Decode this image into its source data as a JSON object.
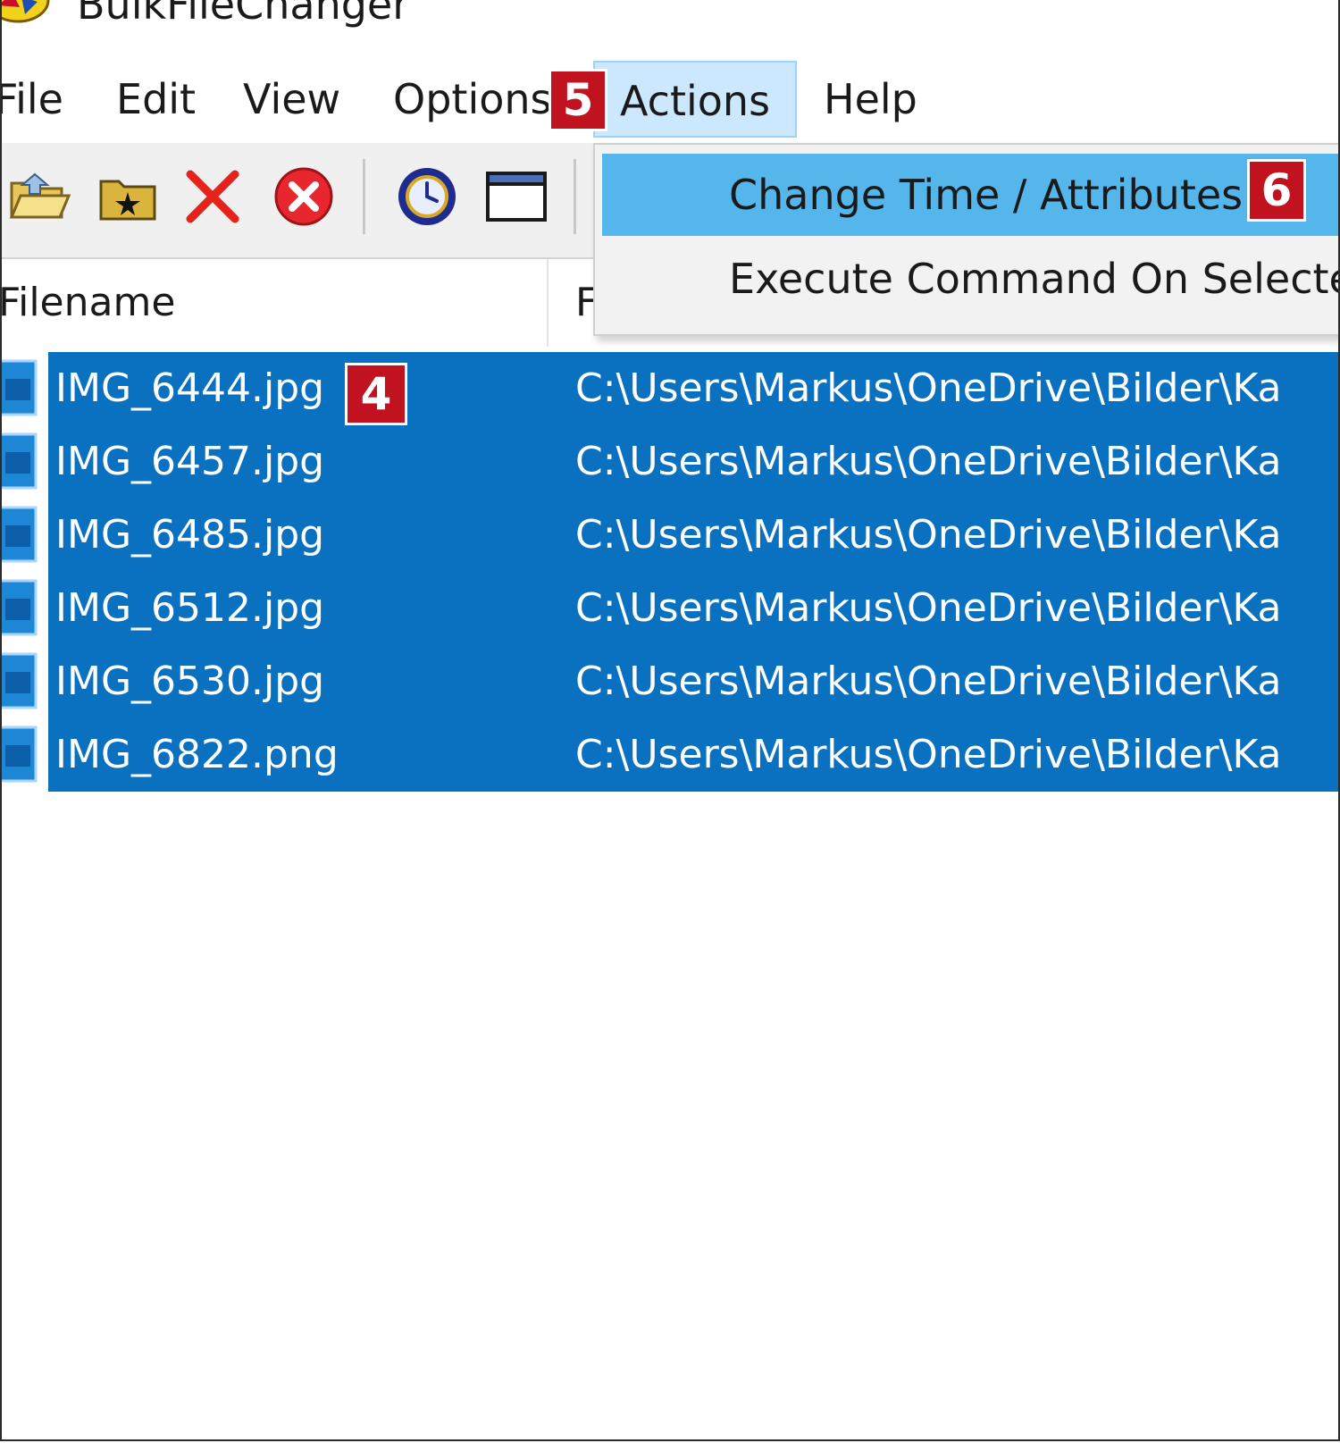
{
  "window": {
    "title": "BulkFileChanger"
  },
  "menu": {
    "items": [
      "File",
      "Edit",
      "View",
      "Options",
      "Actions",
      "Help"
    ],
    "active": "Actions"
  },
  "toolbar": {
    "buttons": [
      "open-folder-icon",
      "add-folder-icon",
      "delete-icon",
      "stop-icon",
      "clock-icon",
      "window-icon"
    ]
  },
  "list": {
    "columns": {
      "filename": "Filename",
      "path": "F"
    },
    "rows": [
      {
        "filename": "IMG_6444.jpg",
        "path": "C:\\Users\\Markus\\OneDrive\\Bilder\\Ka"
      },
      {
        "filename": "IMG_6457.jpg",
        "path": "C:\\Users\\Markus\\OneDrive\\Bilder\\Ka"
      },
      {
        "filename": "IMG_6485.jpg",
        "path": "C:\\Users\\Markus\\OneDrive\\Bilder\\Ka"
      },
      {
        "filename": "IMG_6512.jpg",
        "path": "C:\\Users\\Markus\\OneDrive\\Bilder\\Ka"
      },
      {
        "filename": "IMG_6530.jpg",
        "path": "C:\\Users\\Markus\\OneDrive\\Bilder\\Ka"
      },
      {
        "filename": "IMG_6822.png",
        "path": "C:\\Users\\Markus\\OneDrive\\Bilder\\Ka"
      }
    ]
  },
  "actions_menu": {
    "change_time": "Change Time / Attributes",
    "execute_command": "Execute Command On Selecte"
  },
  "callouts": {
    "files": "4",
    "actions": "5",
    "change_time": "6"
  },
  "colors": {
    "selection": "#0a70c0",
    "menu_highlight": "#55b6ec",
    "active_menu": "#cce8ff",
    "callout": "#c1121f"
  }
}
